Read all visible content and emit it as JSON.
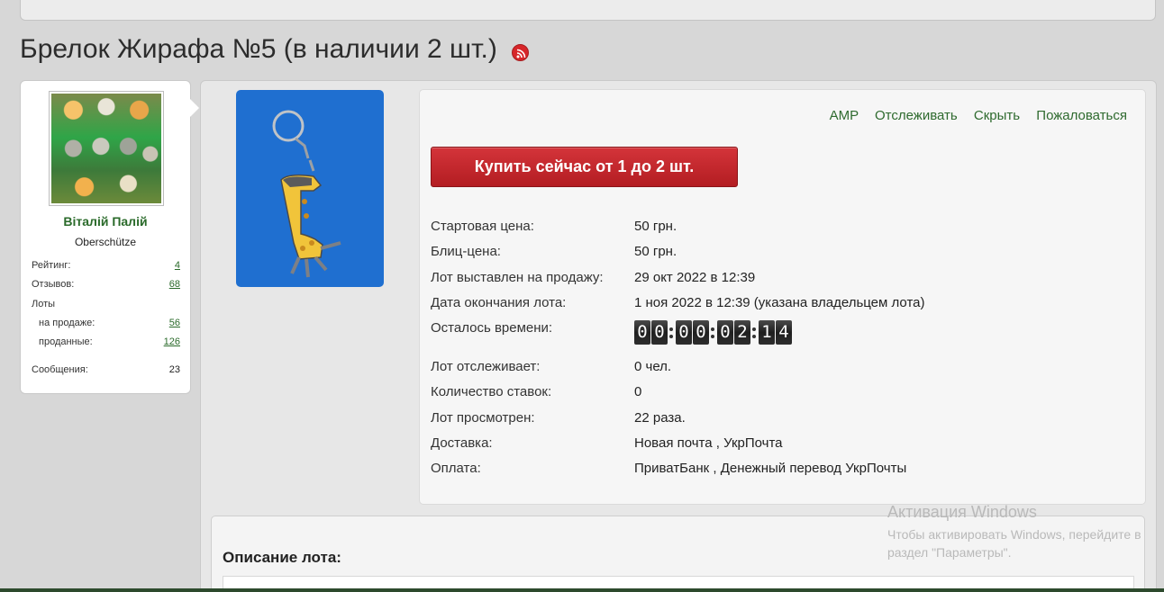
{
  "page": {
    "title": "Брелок Жирафа №5 (в наличии 2 шт.)"
  },
  "seller": {
    "name": "Віталій Палій",
    "location": "Oberschütze",
    "stats": [
      {
        "label": "Рейтинг:",
        "value": "4"
      },
      {
        "label": "Отзывов:",
        "value": "68"
      },
      {
        "label": "Лоты",
        "value": ""
      },
      {
        "label": "на продаже:",
        "value": "56"
      },
      {
        "label": "проданные:",
        "value": "126"
      },
      {
        "label": "Сообщения:",
        "value": "23"
      }
    ]
  },
  "actions": {
    "amp": "AMP",
    "watch": "Отслеживать",
    "hide": "Скрыть",
    "report": "Пожаловаться"
  },
  "buy_button": "Купить сейчас от 1 до 2 шт.",
  "details": [
    {
      "label": "Стартовая цена:",
      "value": "50 грн."
    },
    {
      "label": "Блиц-цена:",
      "value": "50 грн."
    },
    {
      "label": "Лот выставлен на продажу:",
      "value": "29 окт 2022 в 12:39"
    },
    {
      "label": "Дата окончания лота:",
      "value": "1 ноя 2022 в 12:39 (указана владельцем лота)"
    },
    {
      "label": "Осталось времени:",
      "value": ""
    },
    {
      "label": "Лот отслеживает:",
      "value": "0 чел."
    },
    {
      "label": "Количество ставок:",
      "value": "0"
    },
    {
      "label": "Лот просмотрен:",
      "value": "22 раза."
    },
    {
      "label": "Доставка:",
      "value": "Новая почта , УкрПочта"
    },
    {
      "label": "Оплата:",
      "value": "ПриватБанк , Денежный перевод УкрПочты"
    }
  ],
  "timer": {
    "digits": [
      "0",
      "0",
      "0",
      "0",
      "0",
      "2",
      "1",
      "4"
    ]
  },
  "description": {
    "title": "Описание лота:"
  },
  "watermark": {
    "line1": "Активация Windows",
    "line2": "Чтобы активировать Windows, перейдите в раздел \"Параметры\"."
  },
  "colors": {
    "accent_green": "#2e6a2e",
    "buy_red": "#c22a2f",
    "image_blue": "#1f6fd0"
  },
  "icons": {
    "rss": "rss-icon"
  }
}
